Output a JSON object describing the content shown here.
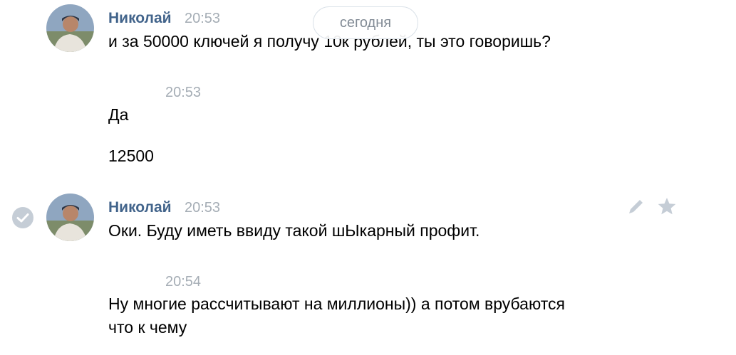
{
  "date_separator": "сегодня",
  "messages": [
    {
      "author": "Николай",
      "time": "20:53",
      "lines": [
        "и за 50000 ключей я получу 10к рублей, ты это говоришь?"
      ]
    },
    {
      "time": "20:53",
      "lines": [
        "Да",
        "12500"
      ]
    },
    {
      "author": "Николай",
      "time": "20:53",
      "lines": [
        "Оки. Буду иметь ввиду такой шЫкарный профит."
      ]
    },
    {
      "time": "20:54",
      "lines": [
        "Ну многие рассчитывают на миллионы)) а потом врубаются",
        "что к чему"
      ]
    }
  ],
  "icons": {
    "selected_check": "check-circle-icon",
    "edit": "pencil-icon",
    "favorite": "star-icon"
  },
  "colors": {
    "author_name": "#42648b",
    "timestamp": "#a5adb5",
    "message_text": "#000000",
    "icon_gray": "#c5cdd6"
  }
}
